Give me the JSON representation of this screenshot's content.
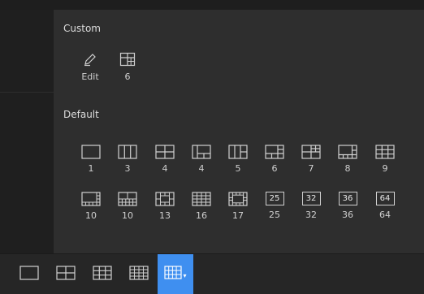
{
  "custom": {
    "title": "Custom",
    "items": [
      {
        "label": "Edit",
        "icon": "pencil-icon"
      },
      {
        "label": "6",
        "icon": "layout-6-custom-icon"
      }
    ]
  },
  "default": {
    "title": "Default",
    "row1": [
      {
        "label": "1",
        "icon": "layout-1-icon"
      },
      {
        "label": "3",
        "icon": "layout-3-icon"
      },
      {
        "label": "4",
        "icon": "layout-4-icon"
      },
      {
        "label": "4",
        "icon": "layout-4b-icon"
      },
      {
        "label": "5",
        "icon": "layout-5-icon"
      },
      {
        "label": "6",
        "icon": "layout-6-icon"
      },
      {
        "label": "7",
        "icon": "layout-7-icon"
      },
      {
        "label": "8",
        "icon": "layout-8-icon"
      },
      {
        "label": "9",
        "icon": "layout-9-icon"
      }
    ],
    "row2": [
      {
        "label": "10",
        "icon": "layout-10-icon"
      },
      {
        "label": "10",
        "icon": "layout-10b-icon"
      },
      {
        "label": "13",
        "icon": "layout-13-icon"
      },
      {
        "label": "16",
        "icon": "layout-16-icon"
      },
      {
        "label": "17",
        "icon": "layout-17-icon"
      },
      {
        "label": "25",
        "icon": "layout-25-icon",
        "box_text": "25"
      },
      {
        "label": "32",
        "icon": "layout-32-icon",
        "box_text": "32"
      },
      {
        "label": "36",
        "icon": "layout-36-icon",
        "box_text": "36"
      },
      {
        "label": "64",
        "icon": "layout-64-icon",
        "box_text": "64"
      }
    ]
  },
  "toolbar": {
    "buttons": [
      {
        "icon": "single-screen-icon"
      },
      {
        "icon": "quad-screen-icon"
      },
      {
        "icon": "nine-screen-icon"
      },
      {
        "icon": "sixteen-screen-icon"
      },
      {
        "icon": "layout-menu-icon",
        "active": true
      }
    ]
  },
  "colors": {
    "accent": "#3f8ff0",
    "panel": "#2e2e2e",
    "background": "#2a2a2a",
    "icon": "#d0d0d0"
  }
}
